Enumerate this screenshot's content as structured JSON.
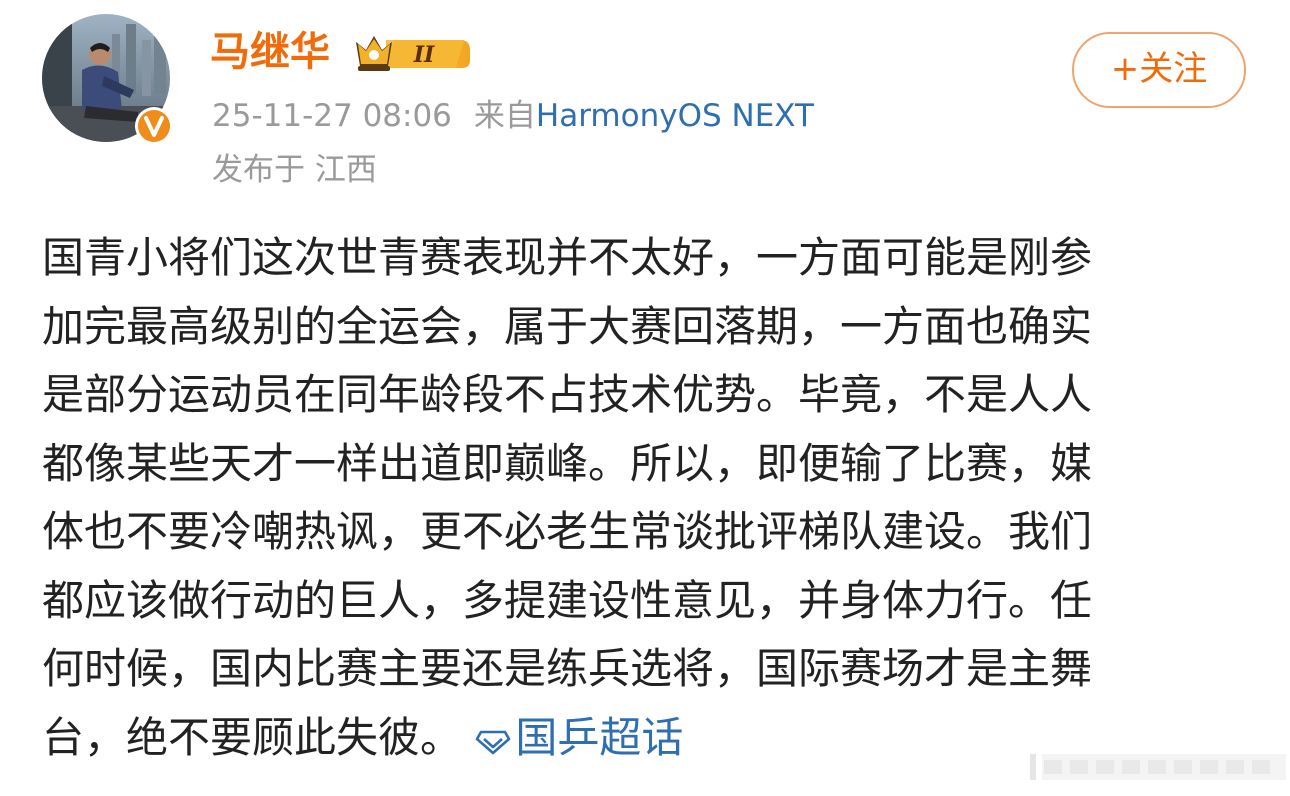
{
  "post": {
    "author": {
      "name": "马继华",
      "level": "II"
    },
    "timestamp": "25-11-27 08:06",
    "source_prefix": "来自",
    "source": "HarmonyOS NEXT",
    "location": "发布于 江西",
    "follow_label": "+关注",
    "content_lines": [
      "国青小将们这次世青赛表现并不太好，一方面可能是刚参",
      "加完最高级别的全运会，属于大赛回落期，一方面也确实",
      "是部分运动员在同年龄段不占技术优势。毕竟，不是人人",
      "都像某些天才一样出道即巅峰。所以，即便输了比赛，媒",
      "体也不要冷嘲热讽，更不必老生常谈批评梯队建设。我们",
      "都应该做行动的巨人，多提建设性意见，并身体力行。任",
      "何时候，国内比赛主要还是练兵选将，国际赛场才是主舞",
      "台，绝不要顾此失彼。"
    ],
    "topic": "国乒超话"
  },
  "colors": {
    "username": "#f26b0a",
    "link": "#2f6fb1",
    "meta": "#9a9a9a",
    "text": "#222222",
    "follow_border": "#f1a36e"
  },
  "icons": {
    "verified": "verified-v-icon",
    "level": "crown-level-icon",
    "topic": "super-topic-diamond-icon"
  }
}
